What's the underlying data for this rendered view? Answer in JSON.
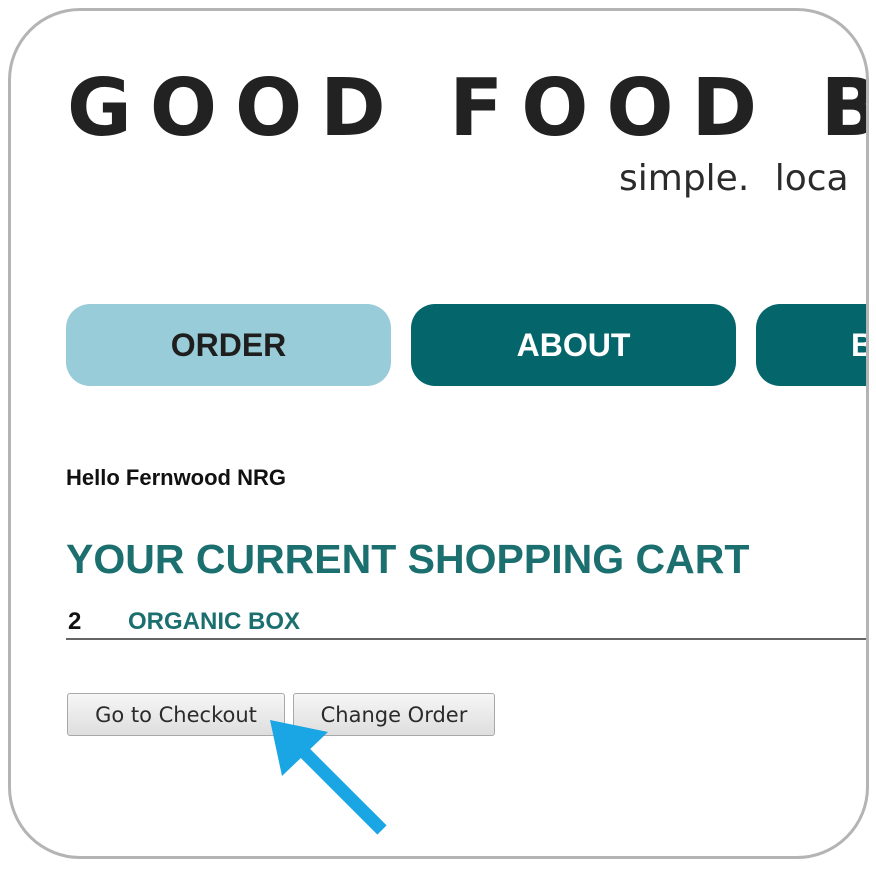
{
  "header": {
    "logo_text": "GOOD FOOD B",
    "tagline": "simple.  loca"
  },
  "nav": {
    "order_label": "ORDER",
    "about_label": "ABOUT",
    "third_label": "B"
  },
  "main": {
    "greeting": "Hello Fernwood NRG",
    "cart_title": "YOUR CURRENT SHOPPING CART",
    "cart_items": [
      {
        "quantity": "2",
        "name": "ORGANIC BOX"
      }
    ],
    "checkout_label": "Go to Checkout",
    "change_label": "Change Order"
  },
  "annotation": {
    "arrow_icon": "pointer-arrow-icon",
    "arrow_color": "#1aa6e4"
  },
  "colors": {
    "accent_dark": "#04666a",
    "accent_light": "#98ccd8",
    "heading": "#1c6f6f"
  }
}
